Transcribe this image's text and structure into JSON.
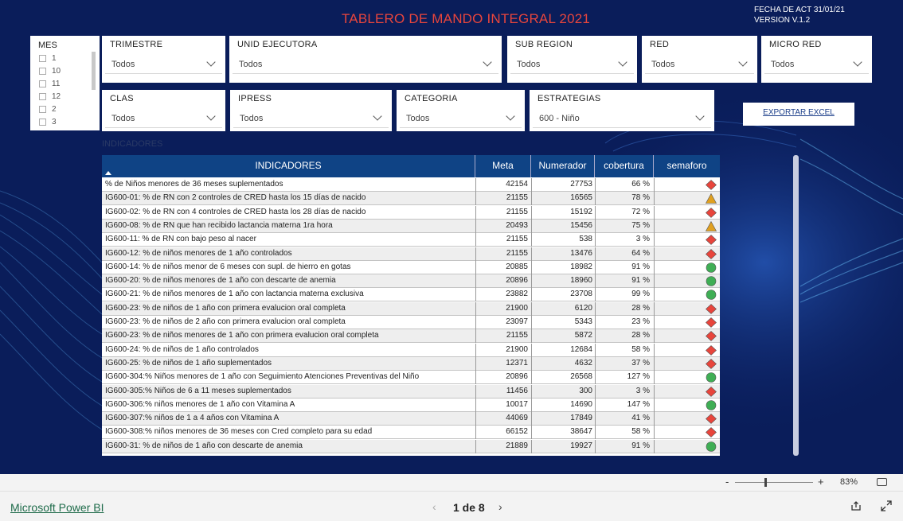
{
  "header": {
    "title": "TABLERO DE MANDO INTEGRAL 2021",
    "fecha": "FECHA DE ACT 31/01/21",
    "version": "VERSION V.1.2"
  },
  "filters": {
    "mes": {
      "label": "MES",
      "items": [
        "1",
        "10",
        "11",
        "12",
        "2",
        "3"
      ]
    },
    "trimestre": {
      "label": "TRIMESTRE",
      "value": "Todos"
    },
    "unid_ejecutora": {
      "label": "UNID EJECUTORA",
      "value": "Todos"
    },
    "sub_region": {
      "label": "SUB REGION",
      "value": "Todos"
    },
    "red": {
      "label": "RED",
      "value": "Todos"
    },
    "micro_red": {
      "label": "MICRO RED",
      "value": "Todos"
    },
    "clas": {
      "label": "CLAS",
      "value": "Todos"
    },
    "ipress": {
      "label": "IPRESS",
      "value": "Todos"
    },
    "categoria": {
      "label": "CATEGORIA",
      "value": "Todos"
    },
    "estrategias": {
      "label": "ESTRATEGIAS",
      "value": "600 - Niño"
    }
  },
  "export_label": "EXPORTAR EXCEL",
  "table_caption": "INDICADORES",
  "table": {
    "headers": [
      "INDICADORES",
      "Meta",
      "Numerador",
      "cobertura",
      "semaforo"
    ],
    "rows": [
      {
        "ind": "% de Niños menores de 36 meses suplementados",
        "meta": "42154",
        "num": "27753",
        "cob": "66 %",
        "sem": "red"
      },
      {
        "ind": "IG600-01: % de RN con 2 controles de CRED hasta los 15 días de nacido",
        "meta": "21155",
        "num": "16565",
        "cob": "78 %",
        "sem": "amber"
      },
      {
        "ind": "IG600-02: % de RN con 4 controles de CRED hasta los 28 días de nacido",
        "meta": "21155",
        "num": "15192",
        "cob": "72 %",
        "sem": "red"
      },
      {
        "ind": "IG600-08: % de RN que han recibido lactancia materna 1ra hora",
        "meta": "20493",
        "num": "15456",
        "cob": "75 %",
        "sem": "amber"
      },
      {
        "ind": "IG600-11: % de RN con bajo peso al nacer",
        "meta": "21155",
        "num": "538",
        "cob": "3 %",
        "sem": "red"
      },
      {
        "ind": "IG600-12: % de niños menores de 1 año controlados",
        "meta": "21155",
        "num": "13476",
        "cob": "64 %",
        "sem": "red"
      },
      {
        "ind": "IG600-14: % de niños menor de 6 meses con supl. de hierro en gotas",
        "meta": "20885",
        "num": "18982",
        "cob": "91 %",
        "sem": "green"
      },
      {
        "ind": "IG600-20: % de niños menores de 1 año con descarte de anemia",
        "meta": "20896",
        "num": "18960",
        "cob": "91 %",
        "sem": "green"
      },
      {
        "ind": "IG600-21: % de niños menores de 1 año con lactancia materna exclusiva",
        "meta": "23882",
        "num": "23708",
        "cob": "99 %",
        "sem": "green"
      },
      {
        "ind": "IG600-23: % de niños de 1 año con primera evalucion oral completa",
        "meta": "21900",
        "num": "6120",
        "cob": "28 %",
        "sem": "red"
      },
      {
        "ind": "IG600-23: % de niños de 2 año con primera evalucion oral completa",
        "meta": "23097",
        "num": "5343",
        "cob": "23 %",
        "sem": "red"
      },
      {
        "ind": "IG600-23: % de niños menores de 1 año con primera evalucion oral completa",
        "meta": "21155",
        "num": "5872",
        "cob": "28 %",
        "sem": "red"
      },
      {
        "ind": "IG600-24: % de niños de 1 año controlados",
        "meta": "21900",
        "num": "12684",
        "cob": "58 %",
        "sem": "red"
      },
      {
        "ind": "IG600-25: % de niños de 1 año suplementados",
        "meta": "12371",
        "num": "4632",
        "cob": "37 %",
        "sem": "red"
      },
      {
        "ind": "IG600-304:% Niños menores de 1 año con Seguimiento Atenciones Preventivas del Niño",
        "meta": "20896",
        "num": "26568",
        "cob": "127 %",
        "sem": "green"
      },
      {
        "ind": "IG600-305:% Niños de 6 a 11 meses suplementados",
        "meta": "11456",
        "num": "300",
        "cob": "3 %",
        "sem": "red"
      },
      {
        "ind": "IG600-306:% niños menores de 1 año con Vitamina A",
        "meta": "10017",
        "num": "14690",
        "cob": "147 %",
        "sem": "green"
      },
      {
        "ind": "IG600-307:% niños de 1 a 4 años con Vitamina A",
        "meta": "44069",
        "num": "17849",
        "cob": "41 %",
        "sem": "red"
      },
      {
        "ind": "IG600-308:% niños menores de 36 meses con Cred completo para su edad",
        "meta": "66152",
        "num": "38647",
        "cob": "58 %",
        "sem": "red"
      },
      {
        "ind": "IG600-31: % de niños de 1 año con descarte de anemia",
        "meta": "21889",
        "num": "19927",
        "cob": "91 %",
        "sem": "green"
      }
    ]
  },
  "semaforo_colors": {
    "red": "#e8453c",
    "amber": "#e0a020",
    "green": "#3fae55"
  },
  "zoom": {
    "minus": "-",
    "plus": "+",
    "percent": "83%"
  },
  "footer": {
    "brand": "Microsoft Power BI",
    "page_indicator": "1 de 8",
    "prev": "‹",
    "next": "›"
  }
}
